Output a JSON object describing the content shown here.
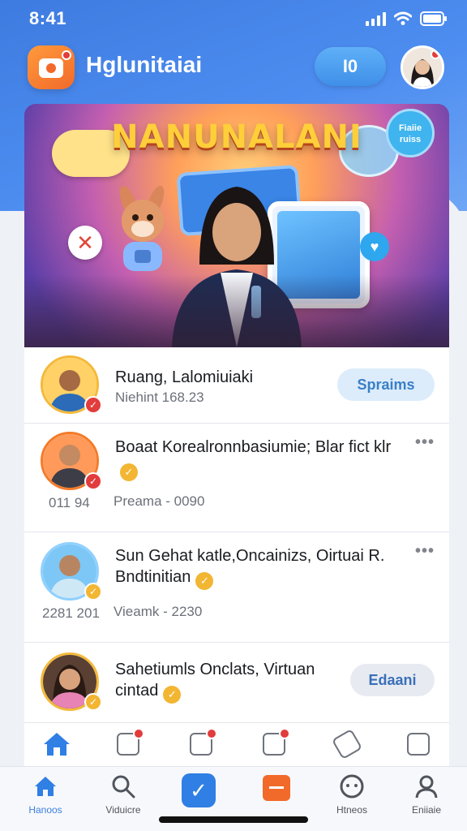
{
  "status_bar": {
    "time": "8:41"
  },
  "header": {
    "app_title": "Hglunitaiai",
    "action_button_label": "I0"
  },
  "banner": {
    "title": "NANUNALANI",
    "badge_text": "Fiaiie ruiss",
    "close_glyph": "✕"
  },
  "list": [
    {
      "title": "Ruang, Lalomiuiaki",
      "subtitle": "Niehint 168.23",
      "button_label": "Spraims",
      "left_meta": ""
    },
    {
      "title": "Boaat Korealronnbasiumie; Blar fict klr",
      "subtitle": "Preama - 0090",
      "button_label": "",
      "left_meta": "011 94"
    },
    {
      "title": "Sun Gehat katle,Oncainizs, Oirtuai R. Bndtinitian",
      "subtitle": "Vieamk - 2230",
      "button_label": "",
      "left_meta": "2281 201"
    },
    {
      "title": "Sahetiumls Onclats, Virtuan cintad",
      "subtitle": "",
      "button_label": "Edaani",
      "left_meta": ""
    }
  ],
  "bottom_nav": [
    {
      "label": "Hanoos",
      "icon": "home-icon"
    },
    {
      "label": "Viduicre",
      "icon": "search-icon"
    },
    {
      "label": "",
      "icon": "check-icon"
    },
    {
      "label": "",
      "icon": "chat-icon"
    },
    {
      "label": "Htneos",
      "icon": "game-controller-icon"
    },
    {
      "label": "Eniiaie",
      "icon": "profile-icon"
    }
  ],
  "colors": {
    "primary": "#3e7be0",
    "accent_orange": "#f26a2a",
    "verified": "#f2b632",
    "alert": "#e23c3c"
  }
}
